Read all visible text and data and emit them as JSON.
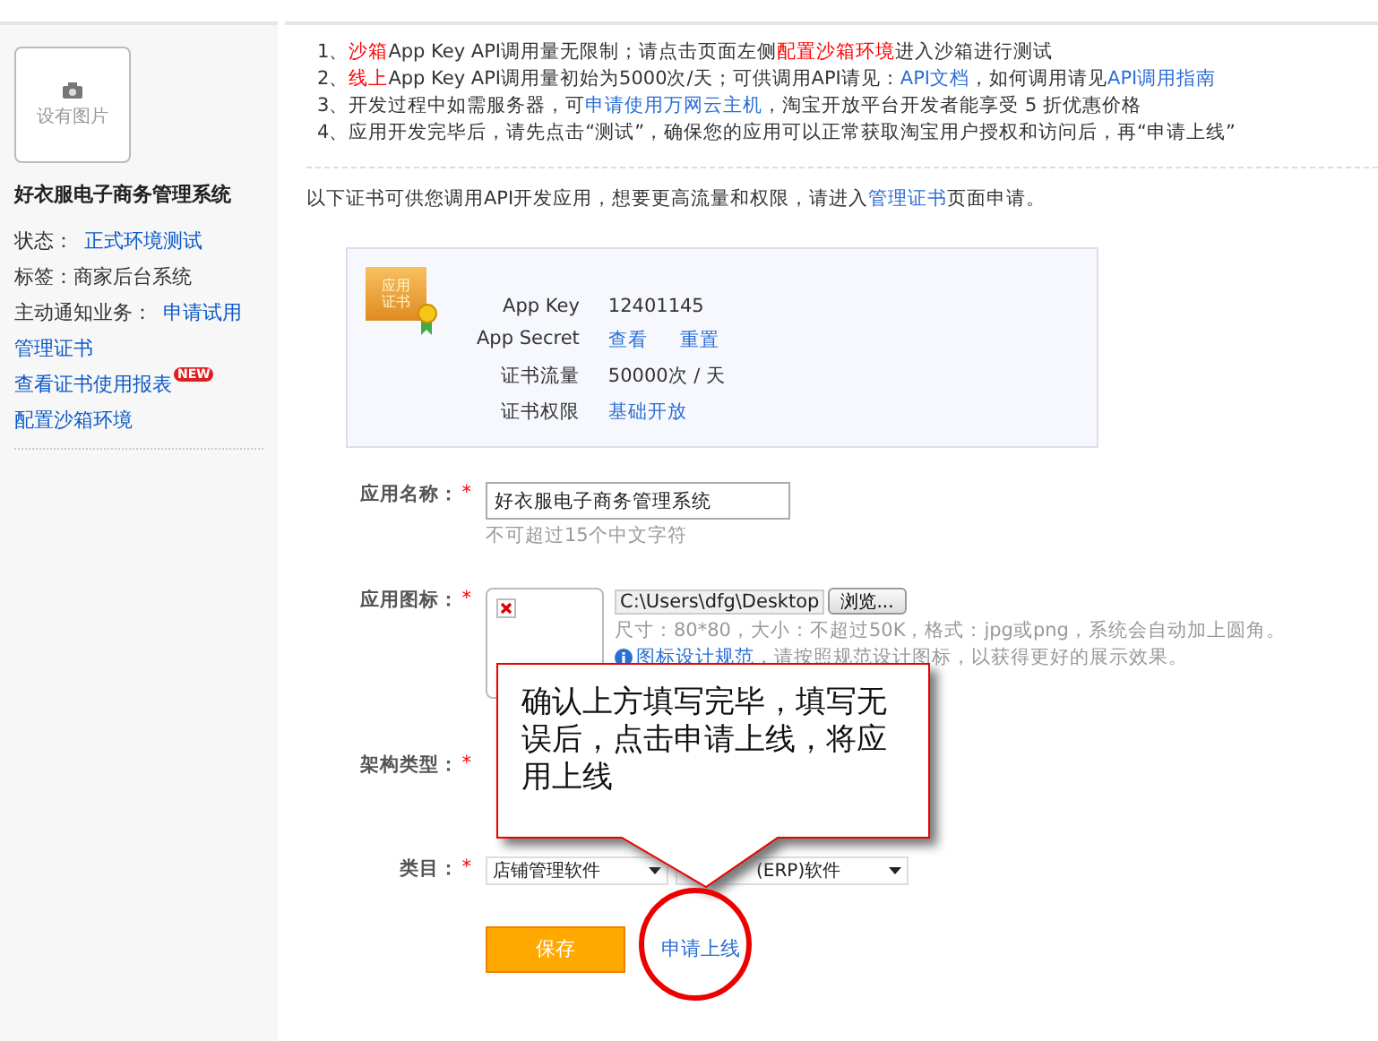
{
  "sidebar": {
    "image_placeholder": "设有图片",
    "app_name": "好衣服电子商务管理系统",
    "items": [
      {
        "kind": "pair",
        "label": "状态：",
        "value": "正式环境测试"
      },
      {
        "kind": "text",
        "label": "标签：商家后台系统"
      },
      {
        "kind": "pair",
        "label": "主动通知业务：",
        "value": "申请试用"
      },
      {
        "kind": "link",
        "label": "管理证书"
      },
      {
        "kind": "link",
        "label": "查看证书使用报表",
        "badge": "NEW"
      },
      {
        "kind": "link",
        "label": "配置沙箱环境"
      }
    ]
  },
  "notes": [
    [
      {
        "kind": "plain",
        "text": "1、"
      },
      {
        "kind": "red",
        "text": "沙箱"
      },
      {
        "kind": "plain",
        "text": "App Key API调用量无限制；请点击页面左侧"
      },
      {
        "kind": "red",
        "text": "配置沙箱环境"
      },
      {
        "kind": "plain",
        "text": "进入沙箱进行测试"
      }
    ],
    [
      {
        "kind": "plain",
        "text": "2、"
      },
      {
        "kind": "red",
        "text": "线上"
      },
      {
        "kind": "plain",
        "text": "App Key API调用量初始为5000次/天；可供调用API请见："
      },
      {
        "kind": "link",
        "text": "API文档"
      },
      {
        "kind": "plain",
        "text": "，如何调用请见"
      },
      {
        "kind": "link",
        "text": "API调用指南"
      }
    ],
    [
      {
        "kind": "plain",
        "text": "3、开发过程中如需服务器，可"
      },
      {
        "kind": "link",
        "text": "申请使用万网云主机"
      },
      {
        "kind": "plain",
        "text": "，淘宝开放平台开发者能享受 5 折优惠价格"
      }
    ],
    [
      {
        "kind": "plain",
        "text": "4、应用开发完毕后，请先点击“测试”，确保您的应用可以正常获取淘宝用户授权和访问后，再“申请上线”"
      }
    ]
  ],
  "cert_intro": [
    {
      "kind": "plain",
      "text": "以下证书可供您调用API开发应用，想要更高流量和权限，请进入"
    },
    {
      "kind": "link",
      "text": "管理证书"
    },
    {
      "kind": "plain",
      "text": "页面申请。"
    }
  ],
  "certificate": {
    "badge": "应用证书",
    "rows": [
      {
        "label": "App Key",
        "values": [
          {
            "kind": "plain",
            "text": "12401145"
          }
        ]
      },
      {
        "label": "App Secret",
        "values": [
          {
            "kind": "link",
            "text": "查看"
          },
          {
            "kind": "link",
            "text": "重置"
          }
        ]
      },
      {
        "label": "证书流量",
        "values": [
          {
            "kind": "plain",
            "text": "50000次 / 天"
          }
        ]
      },
      {
        "label": "证书权限",
        "values": [
          {
            "kind": "link",
            "text": "基础开放"
          }
        ]
      }
    ]
  },
  "form": {
    "required_mark": "*",
    "name": {
      "label": "应用名称：",
      "required": true,
      "value": "好衣服电子商务管理系统",
      "hint": "不可超过15个中文字符"
    },
    "icon": {
      "label": "应用图标：",
      "required": true,
      "file_value": "C:\\Users\\dfg\\Desktop",
      "browse": "浏览...",
      "size_hint": "尺寸：80*80，大小：不超过50K，格式：jpg或png，系统会自动加上圆角。",
      "guide_link": "图标设计规范",
      "guide_text": "，请按照规范设计图标，以获得更好的展示效果。"
    },
    "arch": {
      "label": "架构类型：",
      "required": true
    },
    "category": {
      "label": "类目：",
      "required": true,
      "first": "店铺管理软件",
      "second": "(ERP)软件"
    },
    "save": "保存",
    "submit": "申请上线"
  },
  "callout": "确认上方填写完毕，填写无误后，点击申请上线，将应用上线"
}
